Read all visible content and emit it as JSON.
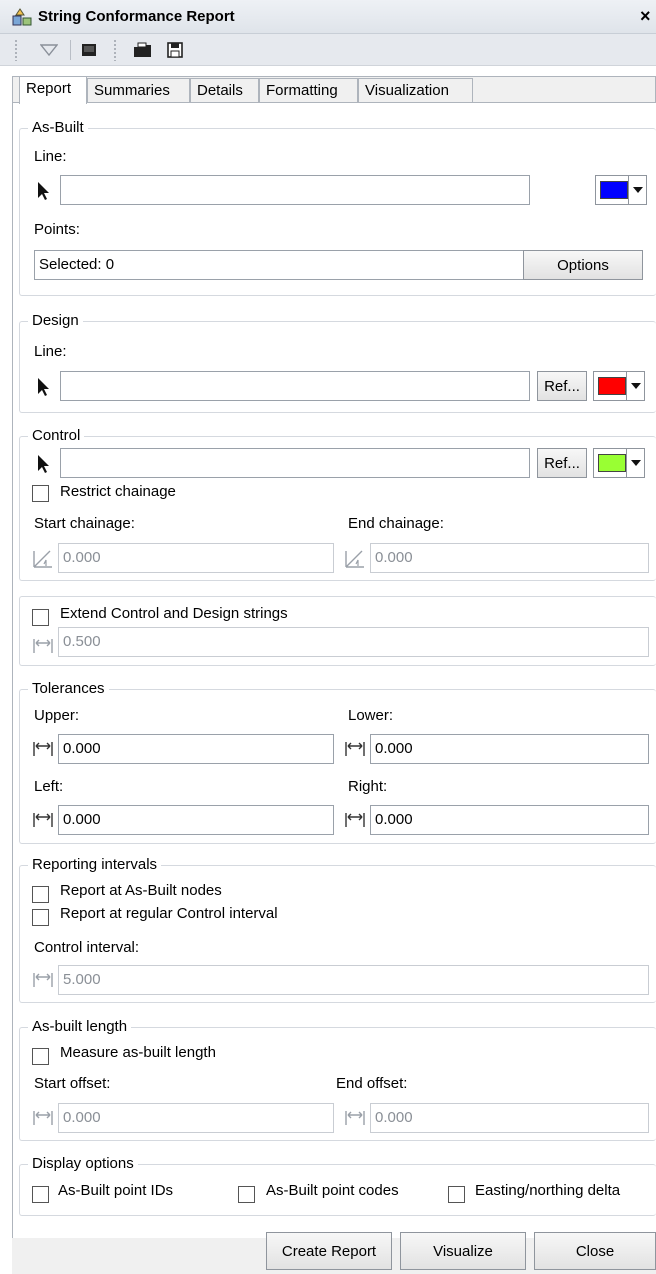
{
  "window": {
    "title": "String Conformance Report",
    "close_glyph": "×"
  },
  "toolbar": {
    "icons": [
      "grip-icon",
      "filter-icon",
      "console-icon",
      "grip-icon",
      "open-folder-icon",
      "save-icon"
    ]
  },
  "tabs": [
    {
      "label": "Report",
      "active": true
    },
    {
      "label": "Summaries"
    },
    {
      "label": "Details"
    },
    {
      "label": "Formatting"
    },
    {
      "label": "Visualization"
    }
  ],
  "as_built": {
    "legend": "As-Built",
    "line_label": "Line:",
    "line_value": "",
    "line_color": "#0000ff",
    "points_label": "Points:",
    "points_value": "Selected: 0",
    "options_button": "Options"
  },
  "design": {
    "legend": "Design",
    "line_label": "Line:",
    "line_value": "",
    "ref_button": "Ref...",
    "line_color": "#ff0000"
  },
  "control": {
    "legend": "Control",
    "line_value": "",
    "ref_button": "Ref...",
    "line_color": "#99ff33",
    "restrict_label": "Restrict chainage",
    "start_label": "Start chainage:",
    "start_value": "0.000",
    "end_label": "End chainage:",
    "end_value": "0.000"
  },
  "extend": {
    "checkbox_label": "Extend Control and Design strings",
    "value": "0.500"
  },
  "tolerances": {
    "legend": "Tolerances",
    "upper_label": "Upper:",
    "upper_value": "0.000",
    "lower_label": "Lower:",
    "lower_value": "0.000",
    "left_label": "Left:",
    "left_value": "0.000",
    "right_label": "Right:",
    "right_value": "0.000"
  },
  "reporting_intervals": {
    "legend": "Reporting intervals",
    "nodes_label": "Report at As-Built nodes",
    "regular_label": "Report at regular Control interval",
    "interval_label": "Control interval:",
    "interval_value": "5.000"
  },
  "as_built_length": {
    "legend": "As-built length",
    "measure_label": "Measure as-built length",
    "start_label": "Start offset:",
    "start_value": "0.000",
    "end_label": "End offset:",
    "end_value": "0.000"
  },
  "display_options": {
    "legend": "Display options",
    "ids_label": "As-Built point IDs",
    "codes_label": "As-Built point codes",
    "delta_label": "Easting/northing delta"
  },
  "footer": {
    "create_report": "Create Report",
    "visualize": "Visualize",
    "close": "Close"
  }
}
